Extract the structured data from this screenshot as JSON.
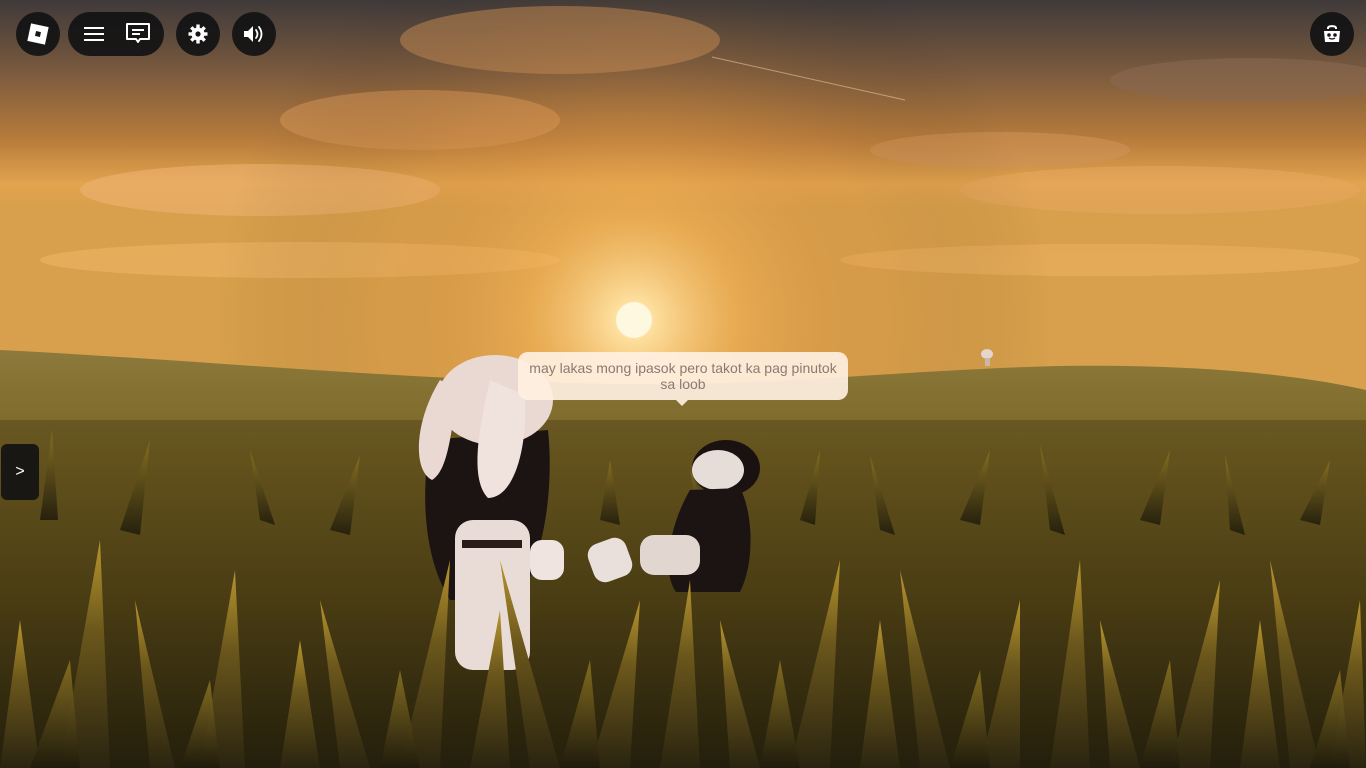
{
  "scene": {
    "description_icon": "sunset-grassland",
    "sky_colors": [
      "#3c3a3c",
      "#c98a3e",
      "#f2c067"
    ],
    "sun_color": "#fff3cc",
    "grass_colors": [
      "#3d3312",
      "#6e5a1c",
      "#a98a2a"
    ]
  },
  "hud": {
    "roblox_icon": "roblox-logo-icon",
    "menu_icon": "hamburger-menu-icon",
    "chat_icon": "chat-icon",
    "settings_icon": "gear-icon",
    "volume_icon": "volume-icon",
    "shop_icon": "backpack-icon",
    "side_toggle_label": ">"
  },
  "chat_bubble": {
    "text": "may lakas mong ipasok pero takot ka pag pinutok sa loob"
  }
}
